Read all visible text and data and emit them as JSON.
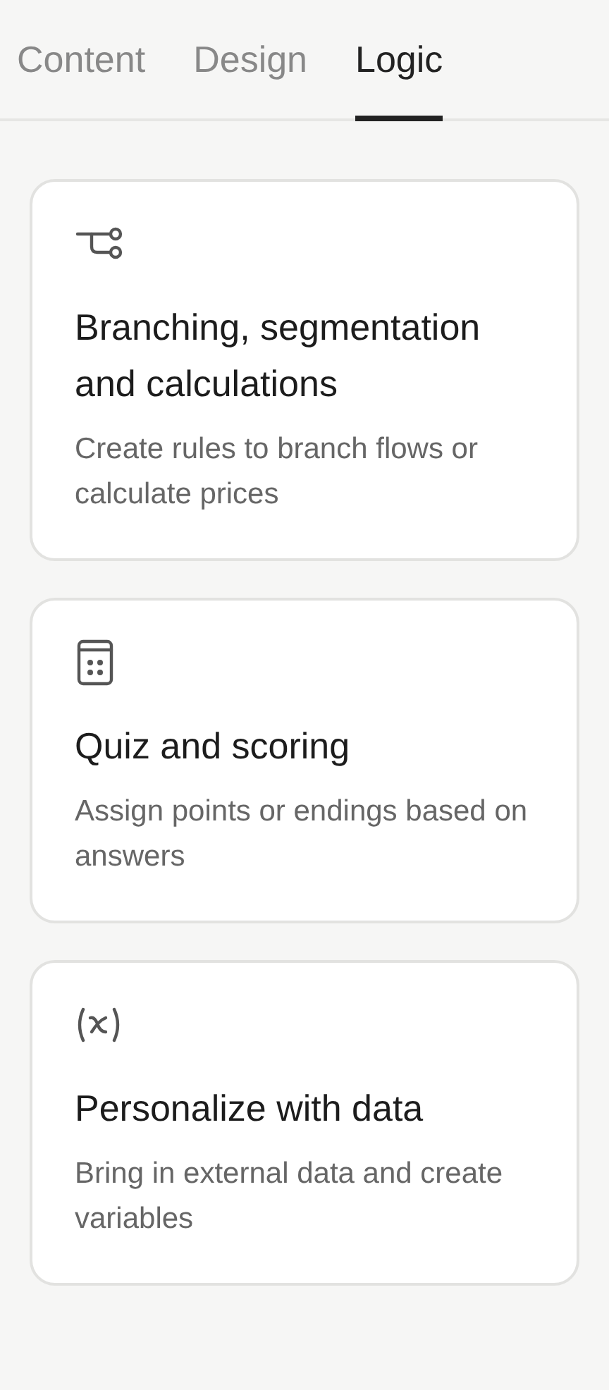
{
  "tabs": [
    {
      "label": "Content",
      "selected": false
    },
    {
      "label": "Design",
      "selected": false
    },
    {
      "label": "Logic",
      "selected": true
    }
  ],
  "cards": [
    {
      "kind": "branch",
      "title": "Branching, segmentation and calculations",
      "description": "Create rules to branch flows or calculate prices"
    },
    {
      "kind": "calculator",
      "title": "Quiz and scoring",
      "description": "Assign points or endings based on answers"
    },
    {
      "kind": "variable",
      "title": "Personalize with data",
      "description": "Bring in external data and create variables"
    }
  ]
}
